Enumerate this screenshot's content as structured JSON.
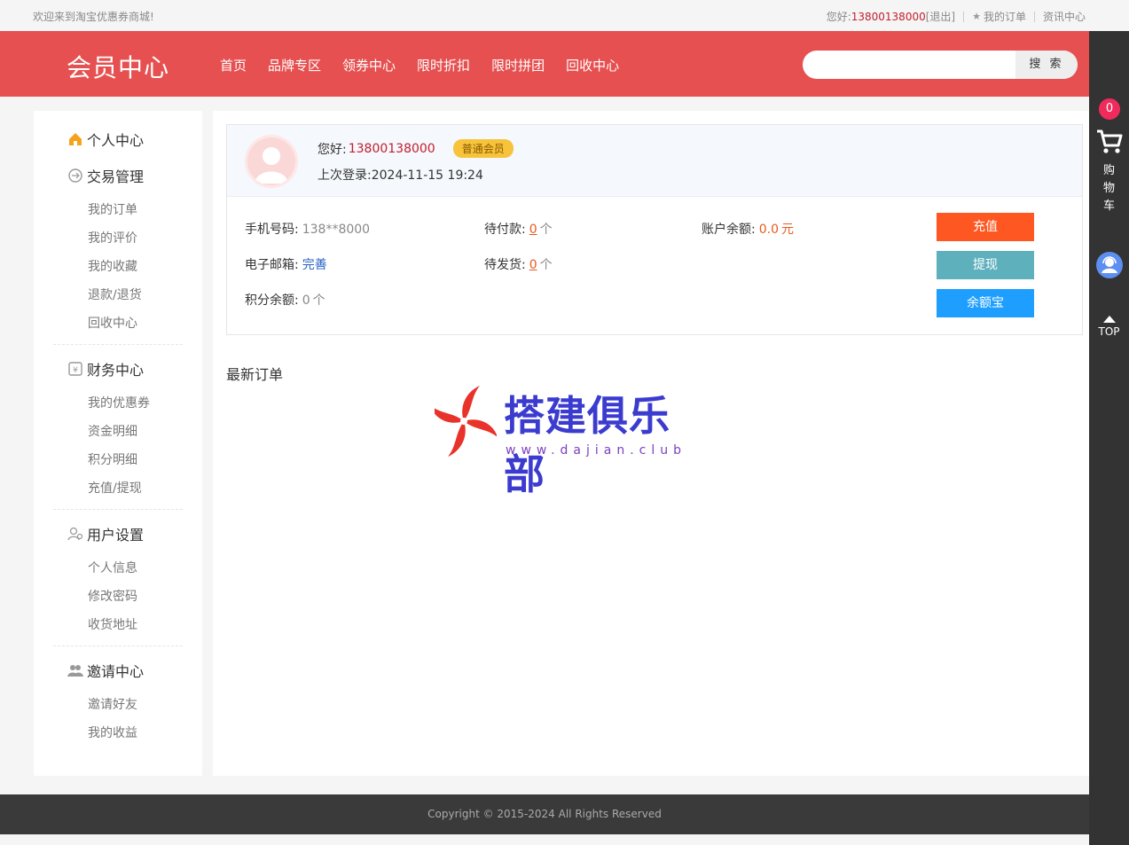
{
  "topbar": {
    "welcome": "欢迎来到淘宝优惠券商城!",
    "hello_prefix": "您好:",
    "phone": "13800138000",
    "logout": "[退出]",
    "my_orders": "我的订单",
    "news": "资讯中心"
  },
  "header": {
    "logo": "会员中心",
    "nav": [
      "首页",
      "品牌专区",
      "领券中心",
      "限时折扣",
      "限时拼团",
      "回收中心"
    ],
    "search_placeholder": "",
    "search_button": "搜 索"
  },
  "rightbar": {
    "cart_count": "0",
    "cart_label": "购\n物\n车",
    "top_label": "TOP"
  },
  "menu": {
    "personal": "个人中心",
    "trade": {
      "title": "交易管理",
      "items": [
        "我的订单",
        "我的评价",
        "我的收藏",
        "退款/退货",
        "回收中心"
      ]
    },
    "finance": {
      "title": "财务中心",
      "items": [
        "我的优惠券",
        "资金明细",
        "积分明细",
        "充值/提现"
      ]
    },
    "user": {
      "title": "用户设置",
      "items": [
        "个人信息",
        "修改密码",
        "收货地址"
      ]
    },
    "invite": {
      "title": "邀请中心",
      "items": [
        "邀请好友",
        "我的收益"
      ]
    }
  },
  "profile": {
    "hello_label": "您好:",
    "username": "13800138000",
    "level": "普通会员",
    "last_login_label": "上次登录:",
    "last_login": "2024-11-15 19:24",
    "phone_label": "手机号码:",
    "phone": "138**8000",
    "email_label": "电子邮箱:",
    "email_action": "完善",
    "points_label": "积分余额:",
    "points": "0",
    "unit": "个",
    "pending_pay_label": "待付款:",
    "pending_pay": "0",
    "pending_ship_label": "待发货:",
    "pending_ship": "0",
    "balance_label": "账户余额:",
    "balance": "0.0",
    "currency": "元",
    "btn_recharge": "充值",
    "btn_withdraw": "提现",
    "btn_yuebao": "余额宝",
    "colors": {
      "recharge": "#ff5722",
      "withdraw": "#5fb0bd",
      "yuebao": "#1e9fff"
    }
  },
  "latest_orders_title": "最新订单",
  "watermark": {
    "title": "搭建俱乐部",
    "url": "www.dajian.club"
  },
  "footer": {
    "copyright": "Copyright © 2015-2024 All Rights Reserved"
  }
}
